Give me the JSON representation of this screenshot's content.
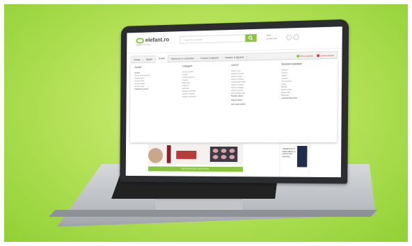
{
  "site": {
    "logo_text": "elefant.ro",
    "logo_tagline": "Magazinul tau online",
    "search_placeholder": "Cauta din produse",
    "account_line1": "Intra",
    "account_line2": "Contul meu"
  },
  "nav": {
    "items": [
      "Acasa",
      "Bebeli",
      "Jucarii",
      "Parfumuri & Cosmetice",
      "Ceasuri & Bijuterii",
      "Fashion & Bijuterii"
    ],
    "active_index": 2,
    "extra1": "Oferte speciale",
    "extra2": "Livrare gratuita"
  },
  "mega": {
    "columns": [
      {
        "title": "Jucarii",
        "items": [
          "Jucarii",
          "Jocuri de societate",
          "Jucarii bebe",
          "Jucarii fetite",
          "Jucarii baieti",
          "Jucarii Lego",
          "Colectii de jucarii"
        ]
      },
      {
        "title": "Categorii",
        "items": [
          "Jocuri puzzle",
          "Cuburi",
          "Jucarii exterior",
          "Papusi",
          "Masinute",
          "Figurine",
          "Vehicule",
          "Jucarii muzicale",
          "Jucarii creative",
          "Jucarii interactive"
        ]
      },
      {
        "title": "LEGO",
        "items": [
          "LEGO City",
          "LEGO Friends",
          "LEGO Duplo",
          "LEGO Technic",
          "LEGO Star Wars",
          "LEGO Creator",
          "LEGO Ninjago",
          "LEGO Juniors",
          "LEGO Minecraft",
          "Noutati LEGO"
        ]
      },
      {
        "title": "Branduri populare",
        "items": [
          "Disney",
          "Chicco",
          "Mattel",
          "Hasbro",
          "Clementoni",
          "Lego",
          "Barbie",
          "Fisher Price",
          "Playmobil",
          "Bburago",
          "Colectia Play-Doh"
        ]
      }
    ],
    "lego_offer": "Oferta LEGO",
    "all_lego_link": "Vezi toate LEGO"
  },
  "content": {
    "cta_label": "VEZI PRODUSELE SELECTATE",
    "side_title": "TREZESTE-TI SIMTURILE cu parfumurile preferate"
  },
  "colors": {
    "background": "#b6e25a",
    "accent_green": "#8bc53f",
    "laptop_bezel": "#2b2d31"
  }
}
